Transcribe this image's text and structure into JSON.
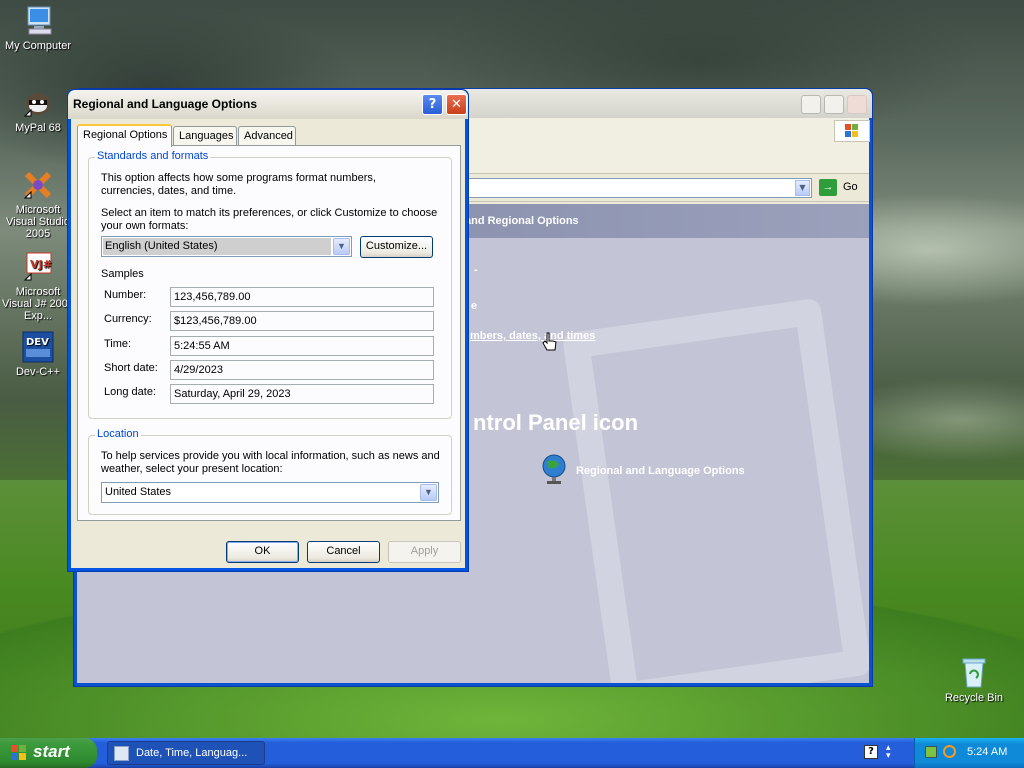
{
  "desktop": {
    "icons": [
      {
        "label": "My Computer"
      },
      {
        "label": "MyPal 68"
      },
      {
        "label": "Microsoft Visual Studio 2005"
      },
      {
        "label": "Microsoft Visual J# 2005 Exp..."
      },
      {
        "label": "Dev-C++"
      },
      {
        "label": "Recycle Bin"
      }
    ]
  },
  "control_panel": {
    "go_label": "Go",
    "header_fragment": "and Regional Options",
    "task_fragment_1": "-",
    "task_fragment_2": "e",
    "task_link_fragment": "mbers, dates, and times",
    "icon_heading_fragment": "ntrol Panel icon",
    "regional_icon_label": "Regional and Language Options"
  },
  "dialog": {
    "title": "Regional and Language Options",
    "help_symbol": "?",
    "close_symbol": "✕",
    "tabs": [
      {
        "label": "Regional Options",
        "active": true
      },
      {
        "label": "Languages",
        "active": false
      },
      {
        "label": "Advanced",
        "active": false
      }
    ],
    "standards": {
      "legend": "Standards and formats",
      "description": "This option affects how some programs format numbers, currencies, dates, and time.",
      "select_prompt": "Select an item to match its preferences, or click Customize to choose your own formats:",
      "selected_format": "English (United States)",
      "customize_label": "Customize...",
      "samples_label": "Samples",
      "samples": [
        {
          "label": "Number:",
          "value": "123,456,789.00"
        },
        {
          "label": "Currency:",
          "value": "$123,456,789.00"
        },
        {
          "label": "Time:",
          "value": "5:24:55 AM"
        },
        {
          "label": "Short date:",
          "value": "4/29/2023"
        },
        {
          "label": "Long date:",
          "value": "Saturday, April 29, 2023"
        }
      ]
    },
    "location": {
      "legend": "Location",
      "description": "To help services provide you with local information, such as news and weather, select your present location:",
      "selected": "United States"
    },
    "buttons": {
      "ok": "OK",
      "cancel": "Cancel",
      "apply": "Apply"
    }
  },
  "taskbar": {
    "start_label": "start",
    "task_label": "Date, Time, Languag...",
    "clock": "5:24 AM"
  }
}
